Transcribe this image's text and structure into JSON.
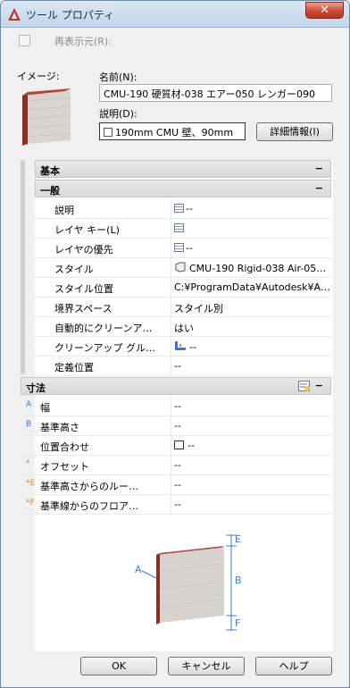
{
  "window": {
    "title": "ツール プロパティ",
    "close": "✕"
  },
  "top": {
    "redisplay_label": "再表示元(R):"
  },
  "image": {
    "label": "イメージ:"
  },
  "name": {
    "label": "名前(N):",
    "value": "CMU-190 硬質材-038 エアー050 レンガー090"
  },
  "description": {
    "label": "説明(D):",
    "value": "190mm CMU 壁、90mm",
    "details_button": "詳細情報(I)"
  },
  "sections": {
    "basic": {
      "title": "基本",
      "toggle": "−"
    },
    "general": {
      "title": "一般",
      "toggle": "−"
    },
    "dimensions": {
      "title": "寸法",
      "toggle": "−"
    }
  },
  "general_rows": [
    {
      "key": "説明",
      "value": "--"
    },
    {
      "key": "レイヤ キー(L)",
      "value": ""
    },
    {
      "key": "レイヤの優先",
      "value": "--"
    },
    {
      "key": "スタイル",
      "value": "CMU-190 Rigid-038 Air-05…"
    },
    {
      "key": "スタイル位置",
      "value": "C:¥ProgramData¥Autodesk¥A…"
    },
    {
      "key": "境界スペース",
      "value": "スタイル別"
    },
    {
      "key": "自動的にクリーンア…",
      "value": "はい"
    },
    {
      "key": "クリーンアップ グル…",
      "value": "--"
    },
    {
      "key": "定義位置",
      "value": "--"
    }
  ],
  "dimension_rows": [
    {
      "marker": "A",
      "key": "幅",
      "value": "--"
    },
    {
      "marker": "B",
      "key": "基準高さ",
      "value": "--"
    },
    {
      "marker": "",
      "key": "位置合わせ",
      "value": "--"
    },
    {
      "marker": "*",
      "key": "オフセット",
      "value": "--"
    },
    {
      "marker": "*E",
      "key": "基準高さからのルー…",
      "value": "--"
    },
    {
      "marker": "*F",
      "key": "基準線からのフロア…",
      "value": "--"
    }
  ],
  "diagram": {
    "labels": [
      "E",
      "A",
      "B",
      "F"
    ]
  },
  "buttons": {
    "ok": "OK",
    "cancel": "キャンセル",
    "help": "ヘルプ"
  },
  "colors": {
    "accent": "#c94a35",
    "marker_blue": "#3a7bd5",
    "marker_orange": "#e0852a"
  }
}
